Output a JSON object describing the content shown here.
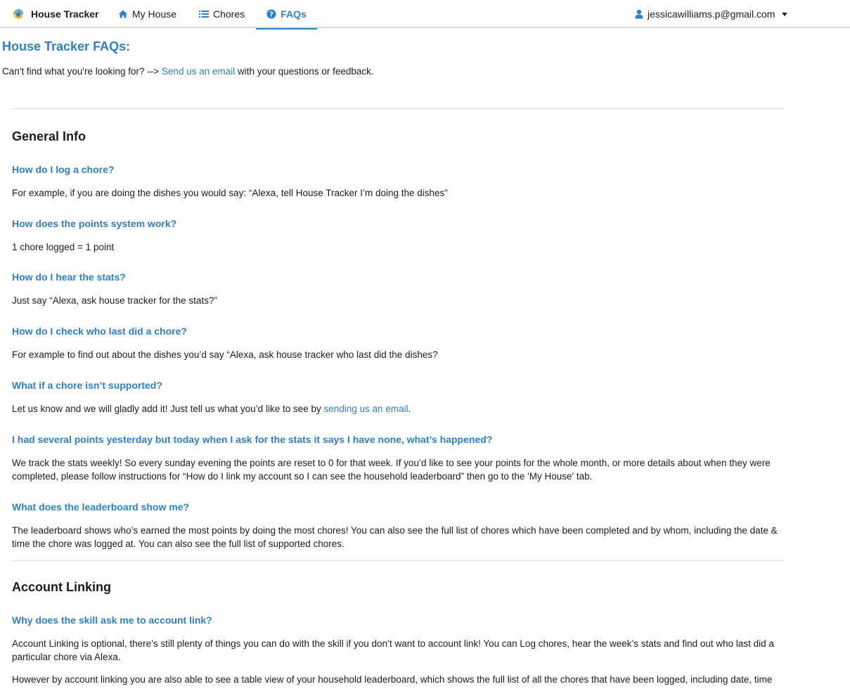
{
  "nav": {
    "brand": "House Tracker",
    "my_house": "My House",
    "chores": "Chores",
    "faqs": "FAQs",
    "user_email": "jessicawilliams.p@gmail.com"
  },
  "page": {
    "title": "House Tracker FAQs:",
    "intro_prefix": "Can't find what you're looking for? -->",
    "intro_link": "Send us an email",
    "intro_suffix": "with your questions or feedback."
  },
  "general": {
    "title": "General Info",
    "q1": "How do I log a chore?",
    "a1": "For example, if you are doing the dishes you would say: “Alexa, tell House Tracker I’m doing the dishes”",
    "q2": "How does the points system work?",
    "a2": "1 chore logged = 1 point",
    "q3": "How do I hear the stats?",
    "a3": "Just say “Alexa, ask house tracker for the stats?”",
    "q4": "How do I check who last did a chore?",
    "a4": "For example to find out about the dishes you’d say “Alexa, ask house tracker who last did the dishes?",
    "q5": "What if a chore isn’t supported?",
    "a5_prefix": "Let us know and we will gladly add it! Just tell us what you’d like to see by",
    "a5_link": "sending us an email",
    "a5_suffix": ".",
    "q6": "I had several points yesterday but today when I ask for the stats it says I have none, what’s happened?",
    "a6": "We track the stats weekly! So every sunday evening the points are reset to 0 for that week. If you’d like to see your points for the whole month, or more details about when they were completed, please follow instructions for “How do I link my account so I can see the household leaderboard” then go to the 'My House' tab.",
    "q7": "What does the leaderboard show me?",
    "a7": "The leaderboard shows who’s earned the most points by doing the most chores! You can also see the full list of chores which have been completed and by whom, including the date & time the chore was logged at. You can also see the full list of supported chores."
  },
  "account": {
    "title": "Account Linking",
    "q1": "Why does the skill ask me to account link?",
    "a1": "Account Linking is optional, there’s still plenty of things you can do with the skill if you don’t want to account link! You can Log chores, hear the week’s stats and find out who last did a particular chore via Alexa.",
    "a1b": "However by account linking you are also able to see a table view of your household leaderboard, which shows the full list of all the chores that have been logged, including date, time"
  },
  "colors": {
    "accent": "#2d7fc7",
    "text": "#1b1c1d",
    "divider": "#dcdddf"
  }
}
